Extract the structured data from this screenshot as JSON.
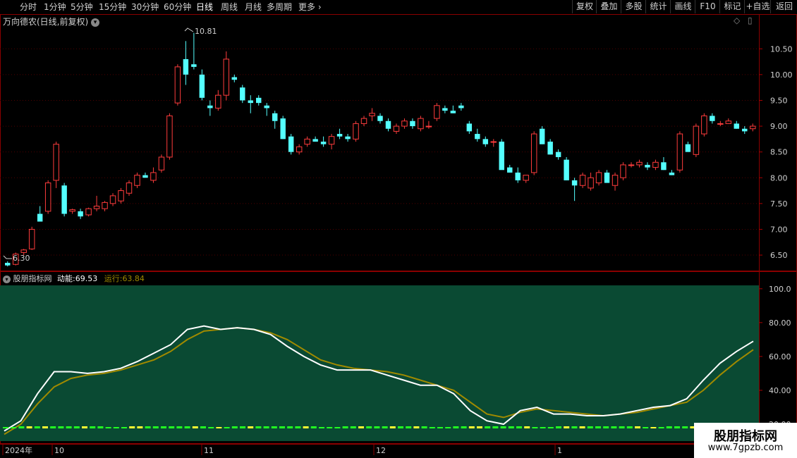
{
  "toolbar": {
    "periods": [
      "分时",
      "1分钟",
      "5分钟",
      "15分钟",
      "30分钟",
      "60分钟",
      "日线",
      "周线",
      "月线",
      "多周期",
      "更多"
    ],
    "active_period": "日线",
    "right_buttons": [
      "复权",
      "叠加",
      "多股",
      "统计",
      "画线",
      "F10",
      "标记",
      "+自选",
      "返回"
    ]
  },
  "main_panel": {
    "title": "万向德农(日线,前复权)",
    "high_label": "10.81",
    "low_label": "6.30",
    "y_ticks": [
      "10.50",
      "10.00",
      "9.50",
      "9.00",
      "8.50",
      "8.00",
      "7.50",
      "7.00",
      "6.50"
    ]
  },
  "indicator_panel": {
    "name": "股朋指标网",
    "line1_label": "动能:",
    "line1_value": "69.53",
    "line2_label": "运行:",
    "line2_value": "63.84",
    "y_ticks": [
      "100.0",
      "80.00",
      "60.00",
      "40.00",
      "20.00"
    ]
  },
  "x_axis": {
    "labels": [
      "2024年",
      "10",
      "11",
      "12",
      "1"
    ]
  },
  "watermark": {
    "title": "股朋指标网",
    "url": "www.7gpzb.com"
  },
  "colors": {
    "up": "#ff3c3c",
    "down": "#54ffff",
    "grid": "#500000",
    "indicator_bg": "#0a4a33",
    "line1": "#ffffff",
    "line2": "#a08a00",
    "volume_bar_a": "#22ff22",
    "volume_bar_b": "#ffff33"
  },
  "chart_data": [
    {
      "type": "candlestick",
      "title": "万向德农(日线,前复权)",
      "ylim": [
        6.2,
        10.9
      ],
      "ohlc": [
        [
          6.35,
          6.38,
          6.28,
          6.3
        ],
        [
          6.32,
          6.55,
          6.3,
          6.52
        ],
        [
          6.55,
          6.62,
          6.5,
          6.6
        ],
        [
          6.62,
          7.05,
          6.6,
          7.0
        ],
        [
          7.3,
          7.45,
          7.15,
          7.15
        ],
        [
          7.35,
          7.95,
          7.3,
          7.9
        ],
        [
          7.95,
          8.7,
          7.8,
          8.65
        ],
        [
          7.85,
          7.9,
          7.25,
          7.3
        ],
        [
          7.35,
          7.4,
          7.3,
          7.38
        ],
        [
          7.35,
          7.4,
          7.2,
          7.25
        ],
        [
          7.28,
          7.42,
          7.25,
          7.4
        ],
        [
          7.4,
          7.65,
          7.35,
          7.45
        ],
        [
          7.4,
          7.55,
          7.35,
          7.52
        ],
        [
          7.5,
          7.7,
          7.45,
          7.65
        ],
        [
          7.55,
          7.8,
          7.5,
          7.75
        ],
        [
          7.7,
          7.95,
          7.65,
          7.9
        ],
        [
          7.85,
          8.1,
          7.8,
          8.05
        ],
        [
          8.05,
          8.1,
          8.0,
          8.0
        ],
        [
          7.95,
          8.2,
          7.9,
          8.1
        ],
        [
          8.15,
          8.45,
          8.1,
          8.4
        ],
        [
          8.4,
          9.25,
          8.35,
          9.2
        ],
        [
          9.45,
          10.2,
          9.4,
          10.15
        ],
        [
          10.3,
          10.65,
          9.8,
          10.0
        ],
        [
          10.2,
          10.81,
          10.1,
          10.15
        ],
        [
          10.0,
          10.1,
          9.5,
          9.55
        ],
        [
          9.4,
          9.5,
          9.2,
          9.35
        ],
        [
          9.35,
          9.7,
          9.3,
          9.6
        ],
        [
          9.6,
          10.45,
          9.5,
          10.3
        ],
        [
          9.95,
          10.0,
          9.85,
          9.9
        ],
        [
          9.75,
          9.8,
          9.45,
          9.5
        ],
        [
          9.5,
          9.6,
          9.25,
          9.45
        ],
        [
          9.55,
          9.6,
          9.4,
          9.45
        ],
        [
          9.4,
          9.45,
          9.2,
          9.35
        ],
        [
          9.25,
          9.3,
          8.95,
          9.1
        ],
        [
          9.15,
          9.2,
          8.75,
          8.75
        ],
        [
          8.8,
          8.85,
          8.45,
          8.5
        ],
        [
          8.5,
          8.65,
          8.45,
          8.6
        ],
        [
          8.65,
          8.8,
          8.6,
          8.75
        ],
        [
          8.75,
          8.8,
          8.7,
          8.7
        ],
        [
          8.7,
          8.8,
          8.6,
          8.65
        ],
        [
          8.65,
          8.85,
          8.55,
          8.8
        ],
        [
          8.85,
          8.95,
          8.75,
          8.8
        ],
        [
          8.8,
          8.85,
          8.7,
          8.75
        ],
        [
          8.75,
          9.1,
          8.7,
          9.05
        ],
        [
          9.05,
          9.2,
          9.0,
          9.15
        ],
        [
          9.2,
          9.35,
          9.1,
          9.25
        ],
        [
          9.2,
          9.25,
          9.05,
          9.1
        ],
        [
          9.1,
          9.15,
          8.9,
          8.95
        ],
        [
          8.9,
          9.05,
          8.85,
          9.0
        ],
        [
          9.0,
          9.15,
          8.95,
          9.1
        ],
        [
          9.1,
          9.15,
          8.95,
          9.0
        ],
        [
          8.95,
          9.2,
          8.9,
          9.15
        ],
        [
          9.0,
          9.1,
          8.95,
          9.0
        ],
        [
          9.15,
          9.45,
          9.1,
          9.4
        ],
        [
          9.35,
          9.4,
          9.25,
          9.3
        ],
        [
          9.3,
          9.4,
          9.25,
          9.25
        ],
        [
          9.4,
          9.45,
          9.3,
          9.35
        ],
        [
          9.05,
          9.1,
          8.85,
          8.9
        ],
        [
          8.85,
          8.95,
          8.7,
          8.75
        ],
        [
          8.75,
          8.8,
          8.6,
          8.65
        ],
        [
          8.7,
          8.75,
          8.6,
          8.7
        ],
        [
          8.7,
          8.75,
          8.6,
          8.15
        ],
        [
          8.2,
          8.25,
          8.1,
          8.1
        ],
        [
          8.1,
          8.2,
          7.9,
          7.95
        ],
        [
          7.95,
          8.05,
          7.9,
          8.05
        ],
        [
          8.1,
          8.9,
          8.05,
          8.85
        ],
        [
          8.95,
          9.0,
          8.65,
          8.65
        ],
        [
          8.7,
          8.75,
          8.45,
          8.45
        ],
        [
          8.5,
          8.55,
          8.35,
          8.4
        ],
        [
          8.35,
          8.4,
          7.95,
          7.95
        ],
        [
          7.95,
          8.0,
          7.55,
          7.85
        ],
        [
          7.85,
          8.1,
          7.8,
          8.05
        ],
        [
          7.8,
          8.1,
          7.75,
          8.0
        ],
        [
          7.9,
          8.15,
          7.85,
          8.1
        ],
        [
          8.1,
          8.15,
          7.9,
          7.9
        ],
        [
          7.85,
          8.1,
          7.75,
          8.05
        ],
        [
          8.0,
          8.3,
          7.95,
          8.25
        ],
        [
          8.25,
          8.3,
          8.2,
          8.25
        ],
        [
          8.25,
          8.35,
          8.2,
          8.3
        ],
        [
          8.25,
          8.3,
          8.15,
          8.2
        ],
        [
          8.2,
          8.35,
          8.15,
          8.3
        ],
        [
          8.3,
          8.4,
          8.15,
          8.15
        ],
        [
          8.1,
          8.15,
          8.05,
          8.05
        ],
        [
          8.15,
          8.9,
          8.1,
          8.85
        ],
        [
          8.65,
          8.7,
          8.5,
          8.5
        ],
        [
          8.45,
          9.05,
          8.4,
          9.0
        ],
        [
          8.85,
          9.25,
          8.8,
          9.2
        ],
        [
          9.2,
          9.25,
          9.05,
          9.1
        ],
        [
          9.05,
          9.1,
          9.0,
          9.05
        ],
        [
          9.05,
          9.15,
          9.05,
          9.1
        ],
        [
          9.05,
          9.1,
          8.95,
          8.95
        ],
        [
          8.95,
          9.0,
          8.85,
          8.9
        ],
        [
          8.95,
          9.05,
          8.9,
          9.0
        ]
      ]
    },
    {
      "type": "line",
      "title": "股朋指标网",
      "ylim": [
        10,
        102
      ],
      "series": [
        {
          "name": "动能",
          "values": [
            16,
            22,
            38,
            51,
            51,
            50,
            51,
            53,
            57,
            62,
            67,
            76,
            78,
            76,
            77,
            76,
            73,
            66,
            60,
            55,
            52,
            52,
            52,
            49,
            46,
            43,
            43,
            38,
            28,
            22,
            20,
            28,
            30,
            26,
            26,
            25,
            25,
            26,
            28,
            30,
            31,
            35,
            46,
            56,
            63,
            69
          ]
        },
        {
          "name": "运行",
          "values": [
            14,
            20,
            32,
            42,
            47,
            49,
            50,
            52,
            55,
            58,
            63,
            70,
            75,
            76,
            77,
            76,
            74,
            70,
            64,
            58,
            55,
            53,
            52,
            51,
            49,
            46,
            43,
            40,
            33,
            26,
            24,
            27,
            29,
            28,
            27,
            26,
            25,
            26,
            27,
            29,
            31,
            33,
            40,
            49,
            57,
            64
          ]
        }
      ]
    }
  ]
}
